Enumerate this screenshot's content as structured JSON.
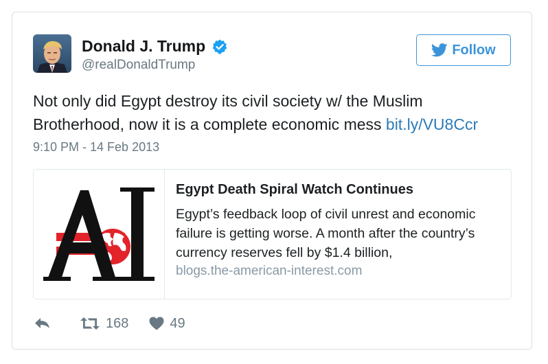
{
  "user": {
    "display_name": "Donald J. Trump",
    "handle": "@realDonaldTrump",
    "verified": true
  },
  "follow_button": {
    "label": "Follow",
    "icon": "twitter-bird-icon"
  },
  "tweet": {
    "text": "Not only did Egypt destroy its civil society w/ the Muslim Brotherhood, now it is a complete economic mess ",
    "link_text": "bit.ly/VU8Ccr",
    "timestamp": "9:10 PM - 14 Feb 2013"
  },
  "link_card": {
    "title": "Egypt Death Spiral Watch Continues",
    "description": "Egypt’s feedback loop of civil unrest and economic failure is getting worse. A month after the country’s currency reserves fell by $1.4 billion,",
    "domain": "blogs.the-american-interest.com",
    "image_logo_text": "AI"
  },
  "actions": {
    "reply": {
      "icon": "reply-icon"
    },
    "retweet": {
      "icon": "retweet-icon",
      "count": "168"
    },
    "like": {
      "icon": "heart-icon",
      "count": "49"
    }
  },
  "colors": {
    "link_blue": "#2b7bb9",
    "follow_blue": "#3b94d9",
    "verified_blue": "#1da1f2",
    "muted_gray": "#697882",
    "logo_red": "#e2232a"
  }
}
